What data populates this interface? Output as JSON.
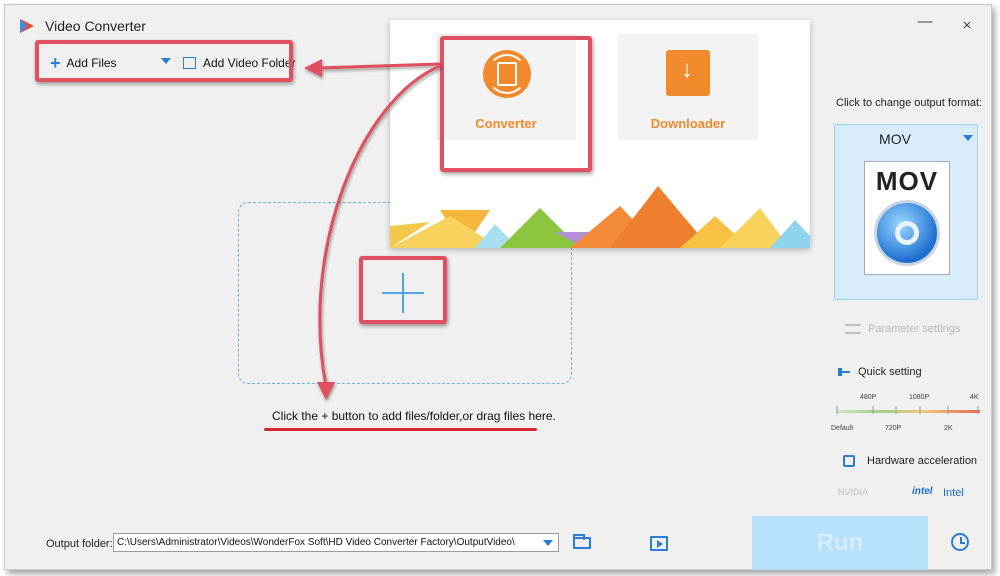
{
  "window": {
    "title": "Video Converter"
  },
  "window_controls": {
    "minimize": "—",
    "close": "×"
  },
  "toolbar": {
    "add_files_label": "Add Files",
    "add_video_folder_label": "Add Video Folder"
  },
  "overlay": {
    "modes": [
      {
        "label": "Converter",
        "icon": "converter-film-icon"
      },
      {
        "label": "Downloader",
        "icon": "download-icon"
      }
    ]
  },
  "dropzone": {
    "hint": "Click the + button to add files/folder,or drag files here."
  },
  "output_format": {
    "prompt": "Click to change output format:",
    "selected": "MOV",
    "icon_text": "MOV"
  },
  "settings": {
    "parameter_settings": "Parameter settings",
    "quick_setting": "Quick setting",
    "quality_top_labels": [
      "480P",
      "1080P",
      "4K"
    ],
    "quality_bottom_labels": [
      "Default",
      "720P",
      "2K"
    ],
    "hardware_acceleration": "Hardware acceleration",
    "nvidia_label": "NVIDIA",
    "intel_logo": "intel",
    "intel_label": "Intel"
  },
  "bottom": {
    "output_folder_label": "Output folder:",
    "output_path": "C:\\Users\\Administrator\\Videos\\WonderFox Soft\\HD Video Converter Factory\\OutputVideo\\",
    "run_label": "Run"
  },
  "colors": {
    "accent": "#2b7cd3",
    "highlight": "#e0505e",
    "orange": "#f08a2c",
    "run_bg": "#b7e1fb"
  }
}
